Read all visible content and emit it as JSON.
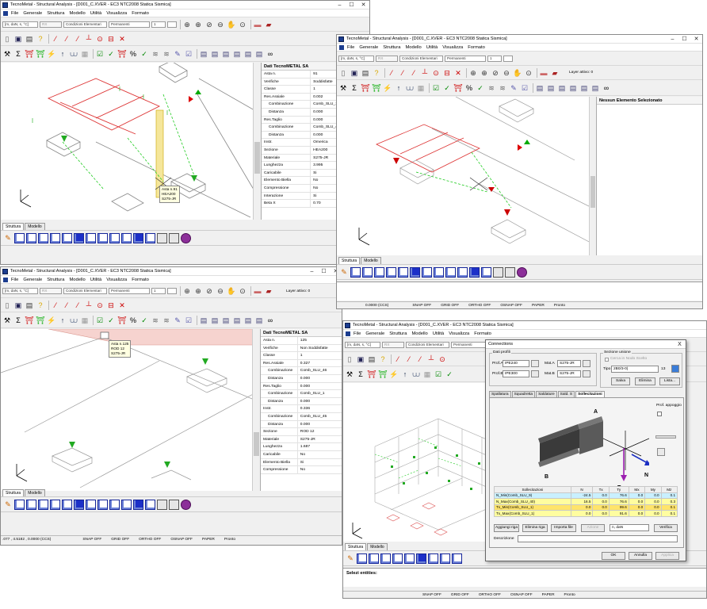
{
  "win1": {
    "title": "TecnoMetal - Structural Analysis - [D001_C.XVER - EC3 NTC2008 Statica Sismica]",
    "menu": [
      "File",
      "Generale",
      "Struttura",
      "Modello",
      "Utilità",
      "Visualizza",
      "Formato"
    ],
    "units": "[m, daN, s, °C]",
    "sel_dis": "RX",
    "combo_elem": "Condizioni Elementari",
    "combo_perm": "Permanenti",
    "step": "1",
    "panel_title": "Dati TecnoMETAL SA",
    "props": [
      [
        "Asta n.",
        "91"
      ],
      [
        "Verifiche",
        "Soddisfatte"
      ],
      [
        "Classe",
        "1"
      ],
      [
        "Res.Assiale",
        "0.002"
      ],
      [
        "Combinazione",
        "Comb_SLU_1"
      ],
      [
        "Distanza",
        "0.000"
      ],
      [
        "Res.Taglio",
        "0.000"
      ],
      [
        "Combinazione",
        "Comb_SLU_45"
      ],
      [
        "Distanza",
        "0.000"
      ],
      [
        "Instr.",
        "Omerica"
      ],
      [
        "Sezione",
        "HEA200"
      ],
      [
        "Materiale",
        "S275-JR"
      ],
      [
        "Lunghezza",
        "3.995"
      ],
      [
        "Caricabile",
        "Si"
      ],
      [
        "Elemento Biella",
        "No"
      ],
      [
        "Compressione",
        "No"
      ],
      [
        "Interazione",
        "Si"
      ],
      [
        "Beta X",
        "0.70"
      ]
    ],
    "tooltip": [
      "Asta n.91",
      "HEA200",
      "S275-JR"
    ],
    "tabs": [
      "Struttura",
      "Modello"
    ]
  },
  "win2": {
    "title": "TecnoMetal - Structural Analysis - [D001_C.XVER - EC3 NTC2008 Statica Sismica]",
    "menu": [
      "File",
      "Generale",
      "Struttura",
      "Modello",
      "Utilità",
      "Visualizza",
      "Formato"
    ],
    "units": "[m, daN, s, °C]",
    "sel_dis": "RX",
    "combo_elem": "Condizioni Elementari",
    "combo_perm": "Permanenti",
    "step": "1",
    "layer": "Layer attivo: 0",
    "panel_title": "Nessun Elemento Selezionato",
    "tabs": [
      "Struttura",
      "Modello"
    ],
    "status": [
      "0.0000 (CCS)",
      "SNAP OFF",
      "GRID OFF",
      "ORTHO OFF",
      "OSNAP OFF",
      "PAPER",
      "Pronto"
    ]
  },
  "win3": {
    "title": "TecnoMetal - Structural Analysis - [D001_C.XVER - EC3 NTC2008 Statica Sismica]",
    "menu": [
      "File",
      "Generale",
      "Struttura",
      "Modello",
      "Utilità",
      "Visualizza",
      "Formato"
    ],
    "units": "[m, daN, s, °C]",
    "sel_dis": "RX",
    "combo_elem": "Condizioni Elementari",
    "combo_perm": "Permanenti",
    "step": "1",
    "layer": "Layer attivo: 0",
    "panel_title": "Dati TecnoMETAL SA",
    "props": [
      [
        "Asta n.",
        "125"
      ],
      [
        "Verifiche",
        "Non Soddisfatte"
      ],
      [
        "Classe",
        "1"
      ],
      [
        "Res.Assiale",
        "0.327"
      ],
      [
        "Combinazione",
        "Comb_SLU_46"
      ],
      [
        "Distanza",
        "0.000"
      ],
      [
        "Res.Taglio",
        "0.000"
      ],
      [
        "Combinazione",
        "Comb_SLU_1"
      ],
      [
        "Distanza",
        "0.000"
      ],
      [
        "Instr.",
        "0.336"
      ],
      [
        "Combinazione",
        "Comb_SLU_45"
      ],
      [
        "Distanza",
        "0.000"
      ],
      [
        "Sezione",
        "ROD 12"
      ],
      [
        "Materiale",
        "S275-JR"
      ],
      [
        "Lunghezza",
        "1.687"
      ],
      [
        "Caricabile",
        "No"
      ],
      [
        "Elemento Biella",
        "Si"
      ],
      [
        "Compressione",
        "No"
      ]
    ],
    "tooltip": [
      "Asta n.125",
      "ROD 12",
      "S275-JR"
    ],
    "tabs": [
      "Struttura",
      "Modello"
    ],
    "status": [
      ".077 , 4.5182 , 0.0000 (CCS)",
      "SNAP OFF",
      "GRID OFF",
      "ORTHO OFF",
      "OSNAP OFF",
      "PAPER",
      "Pronto"
    ]
  },
  "win4": {
    "title": "TecnoMetal - Structural Analysis - [D001_C.XVER - EC3 NTC2008 Statica Sismica]",
    "menu": [
      "File",
      "Generale",
      "Struttura",
      "Modello",
      "Utilità",
      "Visualizza",
      "Formato"
    ],
    "units": "[m, daN, s, °C]",
    "sel_dis": "RX",
    "combo_elem": "Condizioni Elementari",
    "combo_perm": "Permanenti",
    "tabs": [
      "Struttura",
      "Modello"
    ],
    "cmd": "Selezi entities:",
    "status": [
      "SNAP OFF",
      "GRID OFF",
      "ORTHO OFF",
      "OSNAP OFF",
      "PAPER",
      "Pronto"
    ]
  },
  "dialog": {
    "title": "Connections",
    "close": "X",
    "profili": "Dati profili",
    "prof_a_lbl": "Prof.A",
    "prof_a": "IPE240",
    "prof_b_lbl": "Prof.B",
    "prof_b": "IPE300",
    "mat_a_lbl": "Mat.A",
    "mat_a": "S275-JR",
    "mat_b_lbl": "Mat.B",
    "mat_b": "S275-JR",
    "sezione": "Sezione unione",
    "cerca": "Cerca in Nodo Scelto",
    "tipo_lbl": "Tipo",
    "tipo": "2B0/3-0)",
    "tipo_num": "13",
    "btn_salva": "Salva",
    "btn_elimina": "Elimina",
    "btn_lista": "Lista...",
    "tabs": [
      "Spallatura",
      "Squadretta",
      "Saldature",
      "Sald. S",
      "Sollecitazioni"
    ],
    "prof_appoggio": "Prof. appoggio",
    "labels": {
      "a": "A",
      "b": "B",
      "ty": "Ty",
      "n": "N"
    },
    "res_head": [
      "Sollecitazioni",
      "N",
      "Tx",
      "Ty",
      "Mx",
      "My",
      "Mz"
    ],
    "res_rows": [
      [
        "N_Min(Comb_SLU_9)",
        "-24.5",
        "0.0",
        "76.6",
        "0.0",
        "0.0",
        "0.1"
      ],
      [
        "N_Max(Comb_SLU_40)",
        "16.5",
        "0.0",
        "76.6",
        "0.0",
        "0.0",
        "0.3"
      ],
      [
        "Tx_Min(Comb_SLU_1)",
        "0.0",
        "0.0",
        "99.6",
        "0.0",
        "0.0",
        "0.1"
      ],
      [
        "Tx_Max(Comb_SLU_1)",
        "0.0",
        "0.0",
        "91.6",
        "0.0",
        "0.0",
        "0.1"
      ]
    ],
    "btn_aggiungi": "Aggiungi riga",
    "btn_elimina_riga": "Elimina riga",
    "btn_importa": "Importa file",
    "btn_azione": "Azione",
    "unit": "n, daN",
    "btn_verifica": "Verifica",
    "descr_lbl": "Descrizione",
    "btn_ok": "OK",
    "btn_annulla": "Annulla",
    "btn_applica": "Applica"
  }
}
